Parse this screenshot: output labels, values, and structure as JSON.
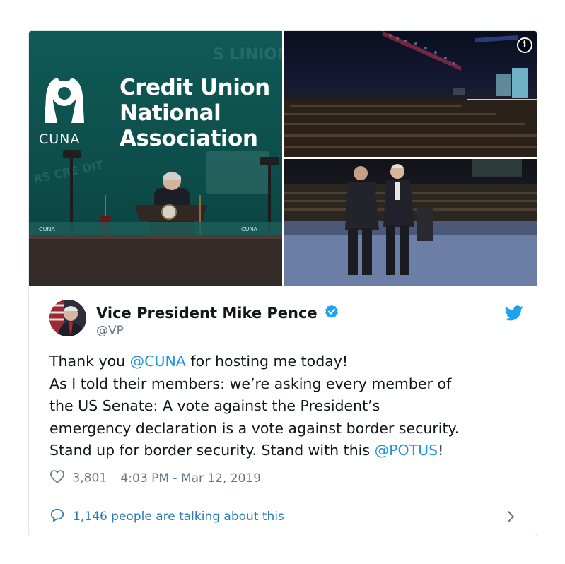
{
  "tweet": {
    "author": {
      "display_name": "Vice President Mike Pence",
      "handle": "@VP",
      "verified": true
    },
    "text_lines": [
      [
        {
          "text": "Thank you ",
          "type": "text"
        },
        {
          "text": "@CUNA",
          "type": "mention"
        },
        {
          "text": " for hosting me today!",
          "type": "text"
        }
      ],
      [
        {
          "text": "As I told their members: we’re asking every member of",
          "type": "text"
        }
      ],
      [
        {
          "text": "the US Senate: A vote against the President’s",
          "type": "text"
        }
      ],
      [
        {
          "text": "emergency declaration is a vote against border security.",
          "type": "text"
        }
      ],
      [
        {
          "text": "Stand up for border security. Stand with this ",
          "type": "text"
        },
        {
          "text": "@POTUS",
          "type": "mention"
        },
        {
          "text": "!",
          "type": "text"
        }
      ]
    ],
    "likes": "3,801",
    "timestamp": "4:03 PM - Mar 12, 2019",
    "conversation_label": "1,146 people are talking about this"
  },
  "media": {
    "banner_line1": "Credit Union",
    "banner_line2": "National",
    "banner_line3": "Association",
    "banner_acronym": "CUNA",
    "info_icon_glyph": "i"
  },
  "icons": {
    "verified": "verified-badge-icon",
    "bird": "twitter-bird-icon",
    "heart": "heart-outline-icon",
    "speech": "speech-bubble-icon",
    "chevron": "chevron-right-icon",
    "info": "info-icon"
  },
  "colors": {
    "link": "#1b95e0",
    "footer_link": "#2b7bb9",
    "text": "#14171a",
    "muted": "#657786",
    "border": "#e1e8ed",
    "brand_teal": "#0f5a57"
  }
}
